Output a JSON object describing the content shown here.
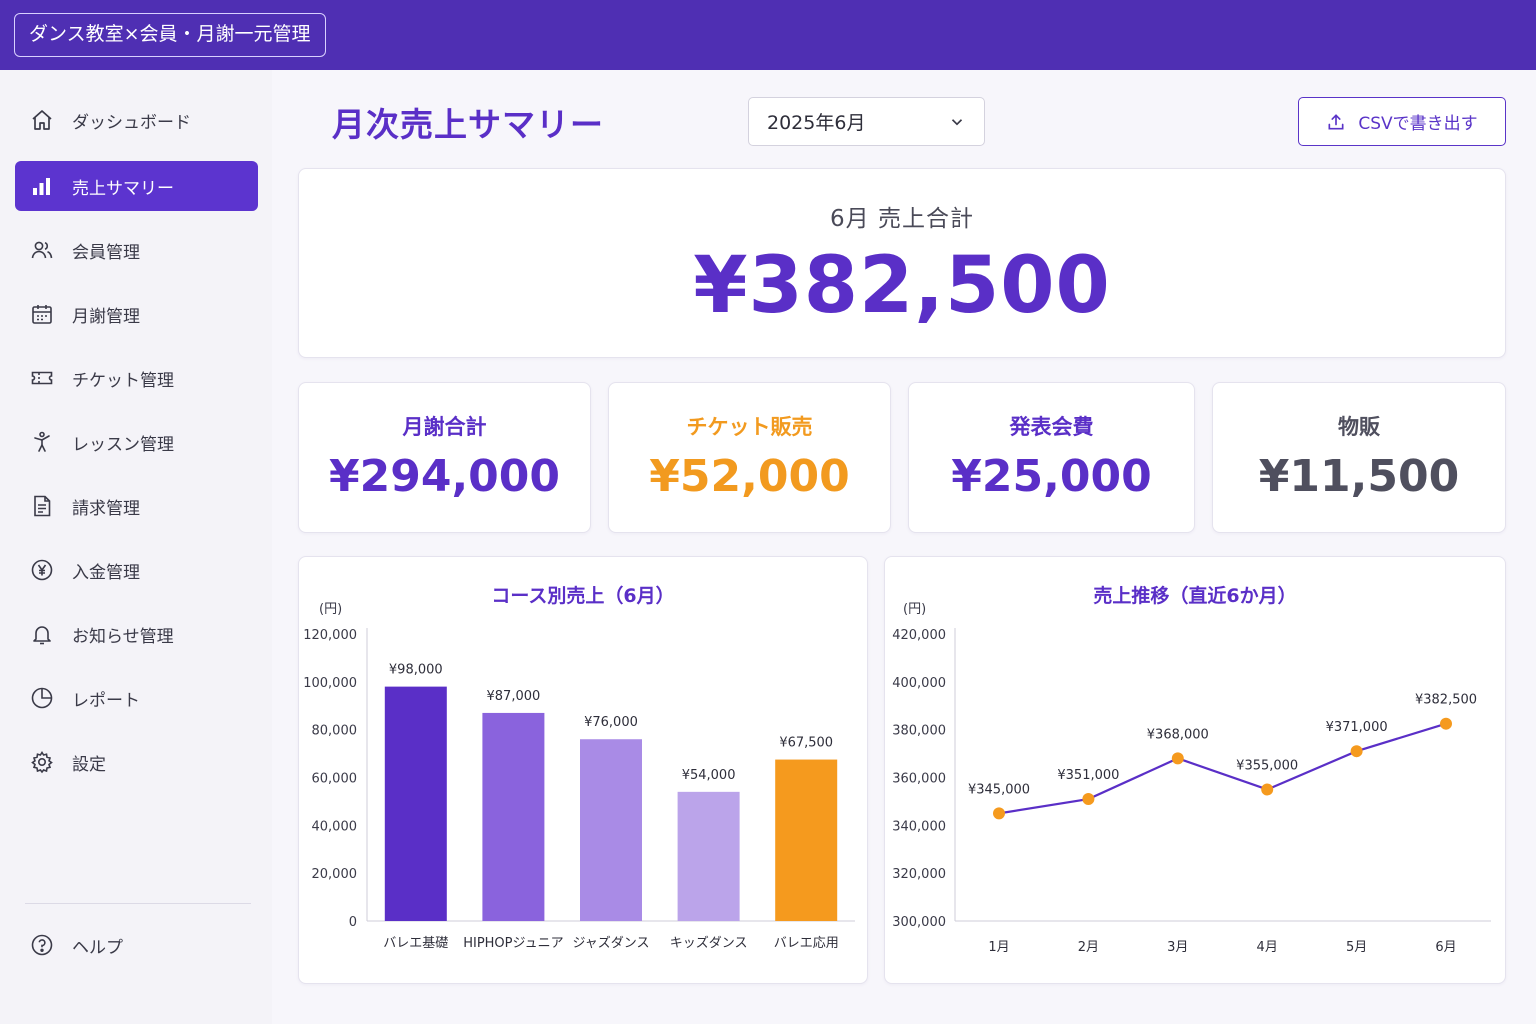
{
  "app": {
    "title": "ダンス教室×会員・月謝一元管理"
  },
  "sidebar": {
    "items": [
      {
        "label": "ダッシュボード",
        "icon": "home-icon",
        "active": false
      },
      {
        "label": "売上サマリー",
        "icon": "bar-chart-icon",
        "active": true
      },
      {
        "label": "会員管理",
        "icon": "users-icon",
        "active": false
      },
      {
        "label": "月謝管理",
        "icon": "calendar-icon",
        "active": false
      },
      {
        "label": "チケット管理",
        "icon": "ticket-icon",
        "active": false
      },
      {
        "label": "レッスン管理",
        "icon": "dancer-icon",
        "active": false
      },
      {
        "label": "請求管理",
        "icon": "document-icon",
        "active": false
      },
      {
        "label": "入金管理",
        "icon": "yen-circle-icon",
        "active": false
      },
      {
        "label": "お知らせ管理",
        "icon": "bell-icon",
        "active": false
      },
      {
        "label": "レポート",
        "icon": "pie-chart-icon",
        "active": false
      },
      {
        "label": "設定",
        "icon": "gear-icon",
        "active": false
      }
    ],
    "help": {
      "label": "ヘルプ",
      "icon": "help-icon"
    }
  },
  "main": {
    "title": "月次売上サマリー",
    "month_select": {
      "value": "2025年6月"
    },
    "csv_button": {
      "label": "CSVで書き出す"
    },
    "total": {
      "label": "6月 売上合計",
      "value": "¥382,500"
    },
    "kpis": [
      {
        "label": "月謝合計",
        "value": "¥294,000",
        "color": "#5a2fc7"
      },
      {
        "label": "チケット販売",
        "value": "¥52,000",
        "color": "#f29a1f"
      },
      {
        "label": "発表会費",
        "value": "¥25,000",
        "color": "#5a2fc7"
      },
      {
        "label": "物販",
        "value": "¥11,500",
        "color": "#4f4f5e"
      }
    ]
  },
  "chart_data": [
    {
      "type": "bar",
      "title": "コース別売上（6月）",
      "ylabel": "(円)",
      "categories": [
        "バレエ基礎",
        "HIPHOPジュニア",
        "ジャズダンス",
        "キッズダンス",
        "バレエ応用"
      ],
      "values": [
        98000,
        87000,
        76000,
        54000,
        67500
      ],
      "data_labels": [
        "¥98,000",
        "¥87,000",
        "¥76,000",
        "¥54,000",
        "¥67,500"
      ],
      "bar_colors": [
        "#5a2fc7",
        "#8a63dd",
        "#a98be6",
        "#bba4ea",
        "#f59a1e"
      ],
      "ylim": [
        0,
        120000
      ],
      "yticks": [
        0,
        20000,
        40000,
        60000,
        80000,
        100000,
        120000
      ],
      "ytick_labels": [
        "0",
        "20,000",
        "40,000",
        "60,000",
        "80,000",
        "100,000",
        "120,000"
      ],
      "grid": false
    },
    {
      "type": "line",
      "title": "売上推移（直近6か月）",
      "ylabel": "(円)",
      "categories": [
        "1月",
        "2月",
        "3月",
        "4月",
        "5月",
        "6月"
      ],
      "values": [
        345000,
        351000,
        368000,
        355000,
        371000,
        382500
      ],
      "data_labels": [
        "¥345,000",
        "¥351,000",
        "¥368,000",
        "¥355,000",
        "¥371,000",
        "¥382,500"
      ],
      "line_color": "#5a2fc7",
      "marker_color": "#f59a1e",
      "ylim": [
        300000,
        420000
      ],
      "yticks": [
        300000,
        320000,
        340000,
        360000,
        380000,
        400000,
        420000
      ],
      "ytick_labels": [
        "300,000",
        "320,000",
        "340,000",
        "360,000",
        "380,000",
        "400,000",
        "420,000"
      ],
      "grid": false
    }
  ]
}
